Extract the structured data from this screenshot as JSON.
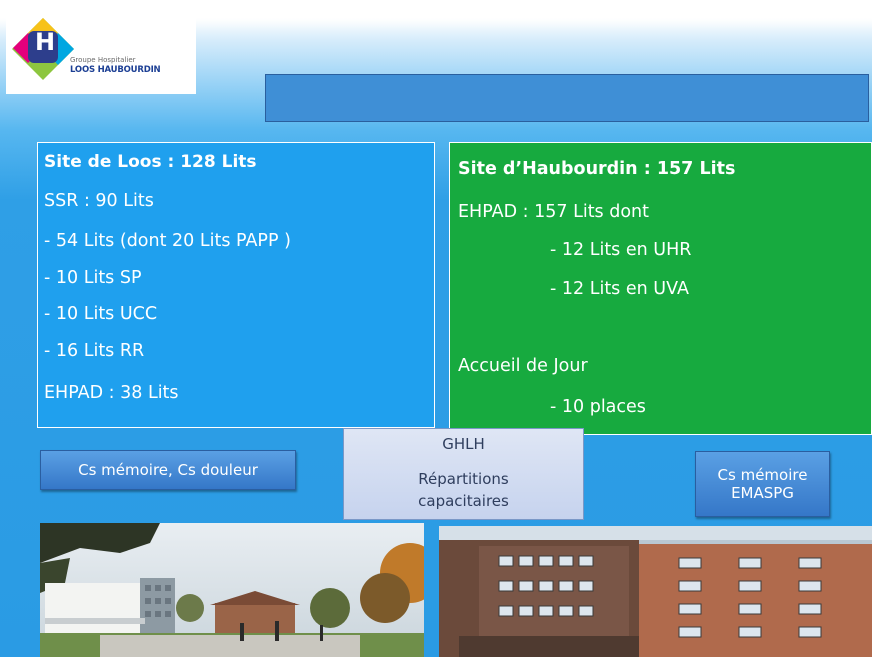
{
  "logo": {
    "letter": "H",
    "line1": "Groupe Hospitalier",
    "line2": "LOOS HAUBOURDIN"
  },
  "title": "",
  "loos": {
    "heading": "Site de Loos : 128 Lits",
    "lines": [
      "SSR : 90 Lits",
      "- 54 Lits (dont  20  Lits PAPP )",
      "- 10 Lits SP",
      "- 10 Lits UCC",
      "- 16 Lits RR",
      "EHPAD : 38 Lits"
    ]
  },
  "hauboudin": {
    "heading": "Site d’Haubourdin : 157 Lits",
    "lines": [
      "EHPAD : 157 Lits dont",
      "- 12 Lits en UHR",
      "- 12 Lits en UVA",
      "Accueil de Jour",
      "- 10 places"
    ]
  },
  "buttons": {
    "left": "Cs mémoire,  Cs douleur",
    "right_line1": "Cs mémoire",
    "right_line2": "EMASPG"
  },
  "center": {
    "line1": "GHLH",
    "line2": "Répartitions",
    "line3": "capacitaires"
  },
  "colors": {
    "loos_box": "#1fa0ee",
    "haub_box": "#17aa3f",
    "logo_blue": "#1c3f94"
  },
  "icons": [
    "hospital-logo-icon"
  ]
}
